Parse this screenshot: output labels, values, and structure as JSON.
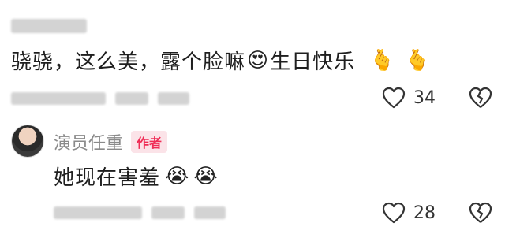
{
  "comment1": {
    "text_before": "骁骁，这么美，露个脸嘛",
    "text_after": "生日快乐",
    "emoji_face": "😍",
    "emoji_hand": "🫰",
    "likes": "34",
    "like_icon": "heart-outline-icon",
    "dislike_icon": "broken-heart-icon"
  },
  "reply": {
    "author": "演员任重",
    "badge": "作者",
    "text": "她现在害羞",
    "emoji": "😭",
    "likes": "28"
  },
  "colors": {
    "badge_bg": "#fbe3e8",
    "badge_text": "#ef2d56",
    "muted_text": "#8a8a8a"
  }
}
